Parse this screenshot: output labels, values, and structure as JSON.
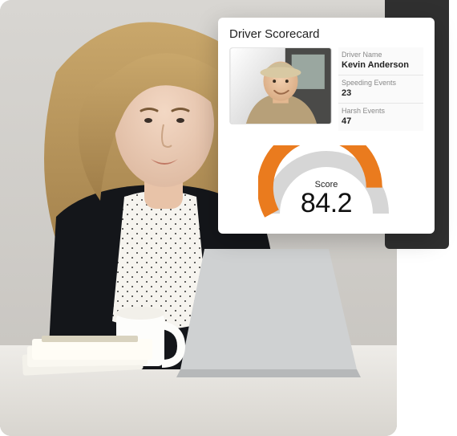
{
  "card": {
    "title": "Driver Scorecard",
    "driver_name_label": "Driver Name",
    "driver_name": "Kevin Anderson",
    "speeding_label": "Speeding Events",
    "speeding_value": "23",
    "harsh_label": "Harsh Events",
    "harsh_value": "47",
    "score_label": "Score",
    "score_value": "84.2"
  },
  "chart_data": {
    "type": "gauge",
    "value": 84.2,
    "min": 0,
    "max": 100,
    "title": "Score",
    "fill_color": "#ea7b1e",
    "track_color": "#d6d6d6"
  }
}
